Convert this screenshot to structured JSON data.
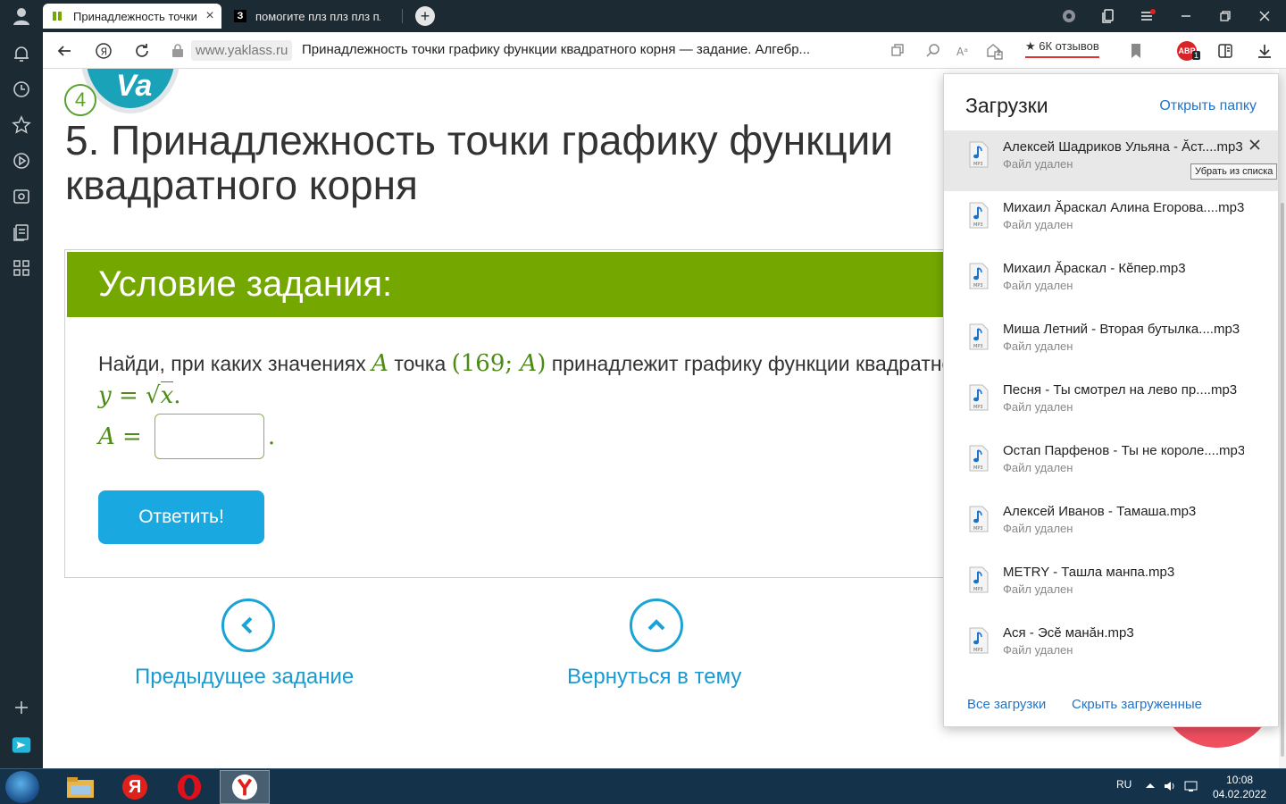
{
  "browser": {
    "tabs": [
      {
        "title": "Принадлежность точки графику функции квадратного корня",
        "active": true
      },
      {
        "title": "помогите плз плз плз плз",
        "favicon_letter": "З",
        "active": false
      }
    ],
    "domain": "www.yaklass.ru",
    "page_title": "Принадлежность точки графику функции квадратного корня — задание. Алгебр...",
    "reviews_badge": "★ 6К отзывов",
    "adblock_badge": "ABP",
    "adblock_count": "1",
    "ext_count": "2"
  },
  "page": {
    "logo_text": "Va",
    "level": "4",
    "task_title": "5. Принадлежность точки графику функции квадратного корня",
    "condition_header": "Условие задания:",
    "question": {
      "part1": "Найди, при каких значениях ",
      "var_a": "A",
      "part2": " точка ",
      "point": "(169; ",
      "point_var": "A",
      "point_close": ")",
      "part3": " принадлежит графику функции квадратного корня"
    },
    "function": {
      "lhs": "y = ",
      "sqrt": "√",
      "arg": "x",
      "end": "."
    },
    "answer_label": "A = ",
    "answer_value": "",
    "answer_end": ".",
    "submit_label": "Ответить!",
    "prev_label": "Предыдущее задание",
    "back_label": "Вернуться в тему"
  },
  "downloads": {
    "title": "Загрузки",
    "open_folder": "Открыть папку",
    "items": [
      {
        "name": "Алексей Шадриков Ульяна - Ӑст....mp3",
        "status": "Файл удален"
      },
      {
        "name": "Михаил Ӑраскал Алина Егорова....mp3",
        "status": "Файл удален"
      },
      {
        "name": "Михаил Ӑраскал - Кĕпер.mp3",
        "status": "Файл удален"
      },
      {
        "name": "Миша Летний - Вторая бутылка....mp3",
        "status": "Файл удален"
      },
      {
        "name": "Песня - Ты смотрел на лево пр....mp3",
        "status": "Файл удален"
      },
      {
        "name": "Остап Парфенов - Ты не короле....mp3",
        "status": "Файл удален"
      },
      {
        "name": "Алексей Иванов - Тамаша.mp3",
        "status": "Файл удален"
      },
      {
        "name": "METRY - Ташла манпа.mp3",
        "status": "Файл удален"
      },
      {
        "name": "Ася - Эсӗ манӑн.mp3",
        "status": "Файл удален"
      }
    ],
    "tooltip": "Убрать из списка",
    "all_downloads": "Все загрузки",
    "hide_downloaded": "Скрыть загруженные",
    "file_icon_label": "MP3"
  },
  "taskbar": {
    "lang": "RU",
    "time": "10:08",
    "date": "04.02.2022",
    "yandex_letter": "Я"
  },
  "colors": {
    "chrome_bg": "#1c2a33",
    "header_green": "#74a800",
    "math_green": "#4d8a17",
    "link_blue": "#1a9ad0",
    "button_blue": "#1aa8e0",
    "downloads_link": "#2673c2"
  }
}
